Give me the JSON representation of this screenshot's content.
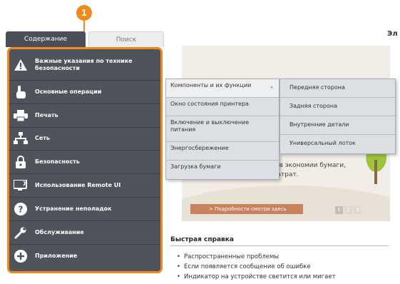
{
  "callout": {
    "number": "1"
  },
  "tabs": {
    "contents": "Содержание",
    "search": "Поиск"
  },
  "sidebar": {
    "items": [
      {
        "label": "Важные указания по технике безопасности",
        "icon": "warning-icon"
      },
      {
        "label": "Основные операции",
        "icon": "hand-pointer-icon"
      },
      {
        "label": "Печать",
        "icon": "printer-icon"
      },
      {
        "label": "Сеть",
        "icon": "network-icon"
      },
      {
        "label": "Безопасность",
        "icon": "lock-icon"
      },
      {
        "label": "Использование Remote UI",
        "icon": "monitor-icon"
      },
      {
        "label": "Устранение неполадок",
        "icon": "question-icon"
      },
      {
        "label": "Обслуживание",
        "icon": "wrench-icon"
      },
      {
        "label": "Приложение",
        "icon": "plus-icon"
      }
    ]
  },
  "main": {
    "title": "Эл",
    "banner": {
      "text_line1": "обов экономии бумаги,",
      "text_line2": "и затрат.",
      "more_button": "> Подробности смотри здесь",
      "pages": [
        "1",
        "2",
        "3"
      ]
    }
  },
  "menu1": {
    "items": [
      "Компоненты и их функции",
      "Окно состояния принтера",
      "Включение и выключение питания",
      "Энергосбережение",
      "Загрузка бумаги"
    ]
  },
  "menu2": {
    "items": [
      "Передняя сторона",
      "Задняя сторона",
      "Внутренние детали",
      "Универсальный лоток"
    ]
  },
  "quick_reference": {
    "title": "Быстрая справка",
    "items": [
      "Распространенные проблемы",
      "Если появляется сообщение об ошибке",
      "Индикатор на устройстве светится или мигает"
    ]
  },
  "colors": {
    "accent": "#f08a1c",
    "sidebar": "#4f545c",
    "menu": "#dcdfe3"
  }
}
